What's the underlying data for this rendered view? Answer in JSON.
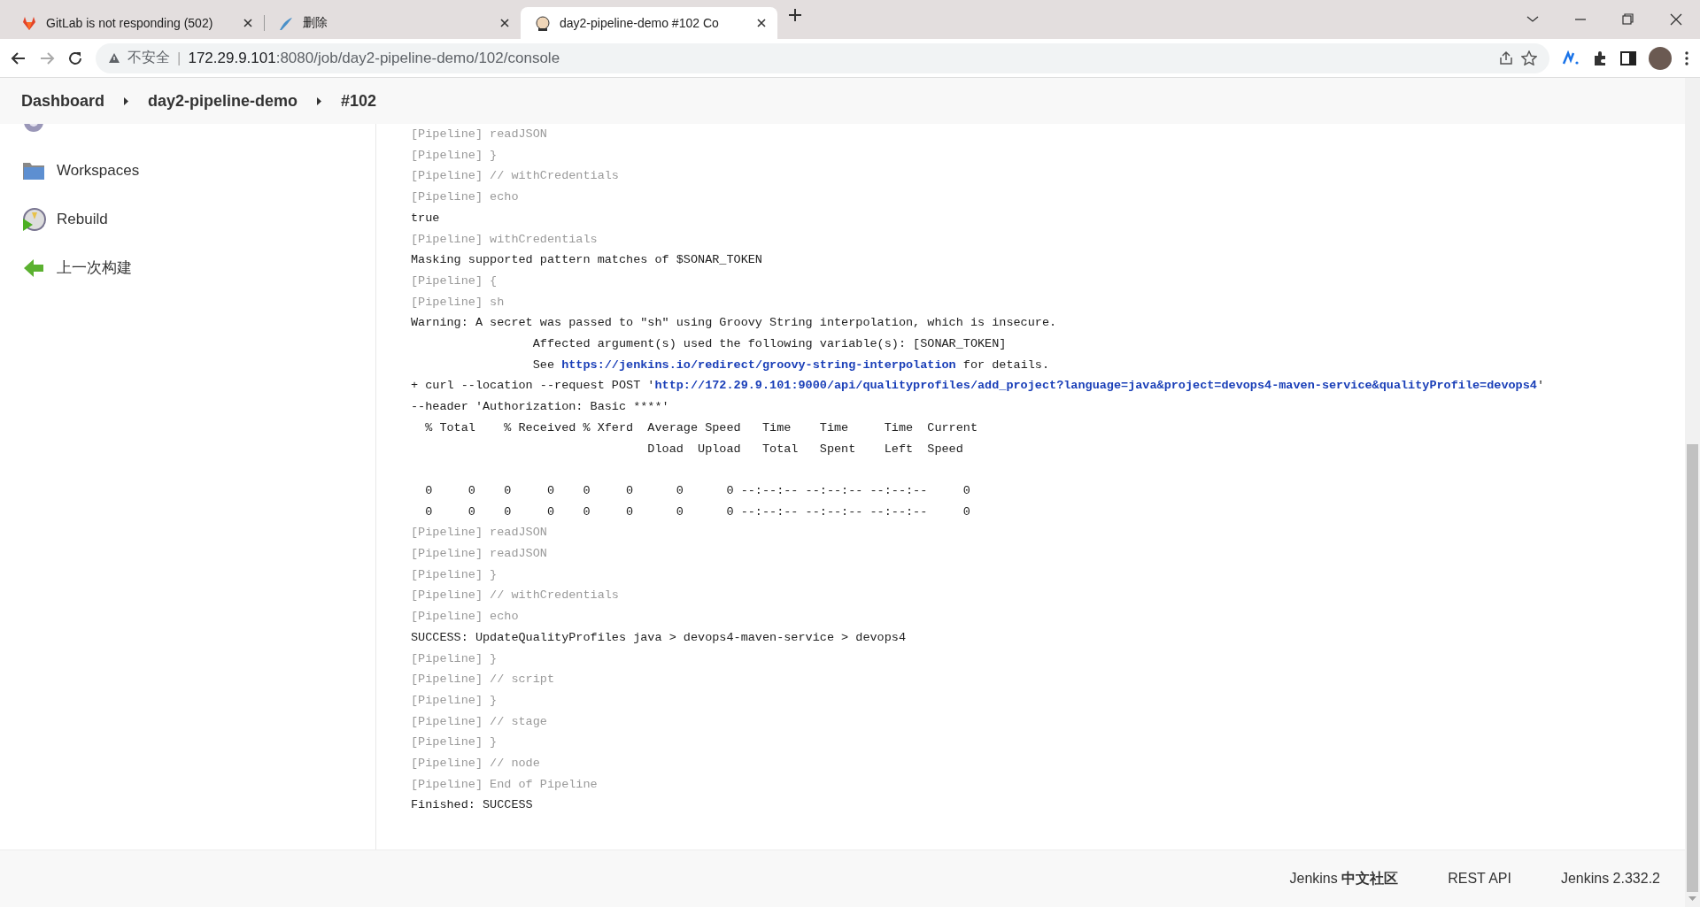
{
  "browser": {
    "tabs": [
      {
        "title": "GitLab is not responding (502)",
        "selected": false
      },
      {
        "title": "删除",
        "selected": false
      },
      {
        "title": "day2-pipeline-demo #102 Co",
        "selected": true
      }
    ],
    "security_label": "不安全",
    "separator": "|",
    "url_host": "172.29.9.101",
    "url_rest": ":8080/job/day2-pipeline-demo/102/console"
  },
  "breadcrumbs": [
    "Dashboard",
    "day2-pipeline-demo",
    "#102"
  ],
  "sidebar": {
    "items": [
      {
        "label": "Workspaces"
      },
      {
        "label": "Rebuild"
      },
      {
        "label": "上一次构建"
      }
    ]
  },
  "console": {
    "lines": [
      {
        "kind": "pipeline",
        "text": "[Pipeline] readJSON"
      },
      {
        "kind": "pipeline",
        "text": "[Pipeline] }"
      },
      {
        "kind": "pipeline",
        "text": "[Pipeline] // withCredentials"
      },
      {
        "kind": "pipeline",
        "text": "[Pipeline] echo"
      },
      {
        "kind": "output",
        "text": "true"
      },
      {
        "kind": "pipeline",
        "text": "[Pipeline] withCredentials"
      },
      {
        "kind": "output",
        "text": "Masking supported pattern matches of $SONAR_TOKEN"
      },
      {
        "kind": "pipeline",
        "text": "[Pipeline] {"
      },
      {
        "kind": "pipeline",
        "text": "[Pipeline] sh"
      },
      {
        "kind": "output",
        "text": "Warning: A secret was passed to \"sh\" using Groovy String interpolation, which is insecure."
      },
      {
        "kind": "output",
        "text": "                 Affected argument(s) used the following variable(s): [SONAR_TOKEN]"
      },
      {
        "kind": "link",
        "text": "                 See ",
        "link": "https://jenkins.io/redirect/groovy-string-interpolation",
        "rest": " for details."
      },
      {
        "kind": "link",
        "text": "+ curl --location --request POST '",
        "link": "http://172.29.9.101:9000/api/qualityprofiles/add_project?language=java&project=devops4-maven-service&qualityProfile=devops4",
        "rest": "'"
      },
      {
        "kind": "output",
        "text": "--header 'Authorization: Basic ****'"
      },
      {
        "kind": "output",
        "text": "  % Total    % Received % Xferd  Average Speed   Time    Time     Time  Current"
      },
      {
        "kind": "output",
        "text": "                                 Dload  Upload   Total   Spent    Left  Speed"
      },
      {
        "kind": "blank"
      },
      {
        "kind": "output",
        "text": "  0     0    0     0    0     0      0      0 --:--:-- --:--:-- --:--:--     0"
      },
      {
        "kind": "output",
        "text": "  0     0    0     0    0     0      0      0 --:--:-- --:--:-- --:--:--     0"
      },
      {
        "kind": "pipeline",
        "text": "[Pipeline] readJSON"
      },
      {
        "kind": "pipeline",
        "text": "[Pipeline] readJSON"
      },
      {
        "kind": "pipeline",
        "text": "[Pipeline] }"
      },
      {
        "kind": "pipeline",
        "text": "[Pipeline] // withCredentials"
      },
      {
        "kind": "pipeline",
        "text": "[Pipeline] echo"
      },
      {
        "kind": "output",
        "text": "SUCCESS: UpdateQualityProfiles java > devops4-maven-service > devops4"
      },
      {
        "kind": "pipeline",
        "text": "[Pipeline] }"
      },
      {
        "kind": "pipeline",
        "text": "[Pipeline] // script"
      },
      {
        "kind": "pipeline",
        "text": "[Pipeline] }"
      },
      {
        "kind": "pipeline",
        "text": "[Pipeline] // stage"
      },
      {
        "kind": "pipeline",
        "text": "[Pipeline] }"
      },
      {
        "kind": "pipeline",
        "text": "[Pipeline] // node"
      },
      {
        "kind": "pipeline",
        "text": "[Pipeline] End of Pipeline"
      },
      {
        "kind": "output",
        "text": "Finished: SUCCESS"
      }
    ]
  },
  "footer": {
    "links": [
      "Jenkins **中文社区**",
      "REST API",
      "Jenkins 2.332.2"
    ]
  }
}
